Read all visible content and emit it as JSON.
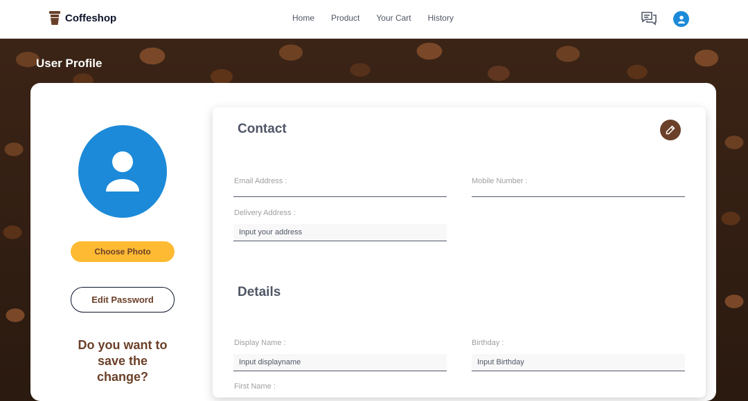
{
  "nav": {
    "brand": "Coffeshop",
    "links": [
      "Home",
      "Product",
      "Your Cart",
      "History"
    ]
  },
  "page_title": "User Profile",
  "profile": {
    "choose_photo": "Choose Photo",
    "edit_password": "Edit Password",
    "question_lines": [
      "Do you want to",
      "save the",
      "change?"
    ]
  },
  "contact": {
    "title": "Contact",
    "email_label": "Email Address :",
    "mobile_label": "Mobile Number :",
    "delivery_label": "Delivery Address :",
    "delivery_placeholder": "Input your address"
  },
  "details": {
    "title": "Details",
    "display_label": "Display Name :",
    "display_placeholder": "Input displayname",
    "birthday_label": "Birthday :",
    "birthday_placeholder": "Input Birthday",
    "first_label": "First Name :"
  },
  "colors": {
    "accent_brown": "#6a4029",
    "accent_yellow": "#ffba33",
    "avatar_blue": "#1c8ad8"
  }
}
